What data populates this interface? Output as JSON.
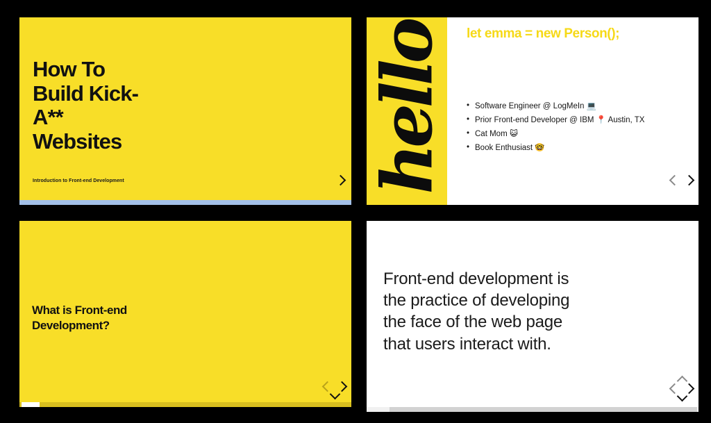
{
  "background_color": "#000000",
  "accent_yellow": "#F8DE28",
  "heading_yellow": "#F6D917",
  "slides": [
    {
      "id": "slide-1",
      "name": "title-slide",
      "background": "#F8DE28",
      "title": "How To\nBuild Kick-\nA**\nWebsites",
      "subtitle": "Introduction to Front-end Development",
      "nav": {
        "next": "next-slide-chevron"
      },
      "scrollbar": {
        "orientation": "horizontal",
        "track": "#D9BF1F",
        "thumb": "#A3C0E8"
      }
    },
    {
      "id": "slide-2",
      "name": "about-me-slide",
      "background": "#FFFFFF",
      "panel_word": "hello",
      "code_heading": "let emma = new Person();",
      "bullets": [
        {
          "text": "Software Engineer @ LogMeIn ",
          "emoji": "💻"
        },
        {
          "text": "Prior Front-end Developer @ IBM ",
          "emoji": "📍",
          "suffix": " Austin, TX"
        },
        {
          "text": "Cat Mom ",
          "emoji": "😺"
        },
        {
          "text": "Book Enthusiast ",
          "emoji": "🤓"
        }
      ],
      "nav": {
        "prev": "prev-slide-chevron",
        "next": "next-slide-chevron"
      }
    },
    {
      "id": "slide-3",
      "name": "section-question-slide",
      "background": "#F8DE28",
      "question": "What is Front-end\nDevelopment?",
      "nav": {
        "prev": "prev-slide-chevron",
        "next": "next-slide-chevron",
        "down": "down-slide-chevron"
      },
      "scrollbar": {
        "orientation": "horizontal",
        "track": "#D9BF1F",
        "thumb": "#FFFFFF"
      }
    },
    {
      "id": "slide-4",
      "name": "definition-slide",
      "background": "#FFFFFF",
      "definition": "Front-end development is\nthe practice of developing\nthe face of the web page\nthat users interact with.",
      "nav": {
        "up": "up-slide-chevron",
        "prev": "prev-slide-chevron",
        "next": "next-slide-chevron",
        "down": "down-slide-chevron"
      },
      "scrollbar": {
        "orientation": "horizontal",
        "track": "#F1F1F1",
        "thumb": "#D2D2D2"
      }
    }
  ]
}
